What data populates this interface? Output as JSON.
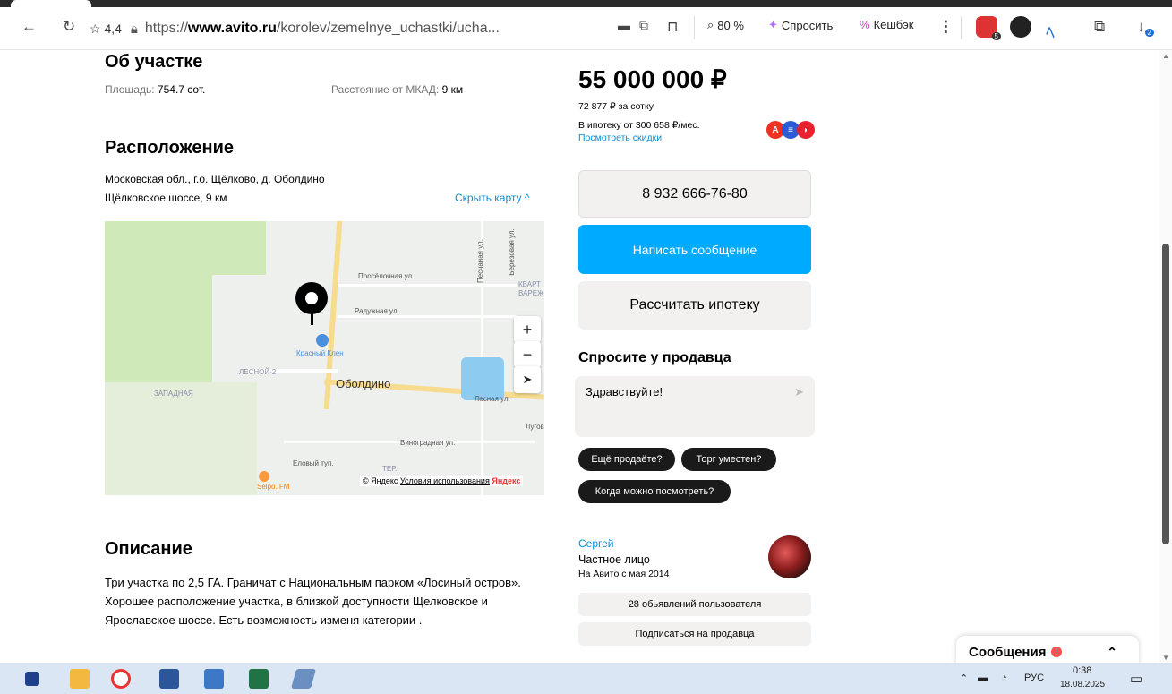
{
  "browser": {
    "rating": "☆ 4,4",
    "url_domain": "www.avito.ru",
    "url_prefix": "https://",
    "url_path": "/korolev/zemelnye_uchastki/ucha...",
    "zoom": "80 %",
    "ask_label": "Спросить",
    "cashback_label": "Кешбэк",
    "ext_badge": "5",
    "download_badge": "2"
  },
  "about": {
    "title": "Об участке",
    "area_label": "Площадь:",
    "area_value": "754.7 сот.",
    "distance_label": "Расстояние от МКАД:",
    "distance_value": "9 км"
  },
  "location": {
    "title": "Расположение",
    "address_line1": "Московская обл., г.о. Щёлково, д. Оболдино",
    "address_line2": "Щёлковское шоссе, 9 км",
    "hide_map": "Скрыть карту ^"
  },
  "map": {
    "place_big": "Оболдино",
    "label_pin_place": "Красный Клен",
    "label_proselochnaya": "Просёлочная ул.",
    "label_raduzhnaya": "Радужная ул.",
    "label_lesnoy2": "ЛЕСНОЙ-2",
    "label_zapadnaya": "ЗАПАДНАЯ",
    "label_lesnaya": "Лесная ул.",
    "label_vinogradnaya": "Виноградная ул.",
    "label_elovy": "Еловый туп.",
    "label_ter": "ТЕР.",
    "label_kvart": "КВАРТ",
    "label_varezh": "ВАРЕЖ",
    "label_lugov": "Лугов",
    "label_pesochnaya": "Песчаная ул.",
    "label_berezovaya": "Берёзовая ул.",
    "label_selpo": "Selpo. FM",
    "copyright": "© Яндекс",
    "terms": "Условия использования",
    "brand": "Яндекс"
  },
  "description": {
    "title": "Описание",
    "text": "Три участка по 2,5 ГА. Граничат с Национальным парком «Лосиный остров». Хорошее расположение участка, в близкой доступности Щелковское и Ярославское шоссе. Есть возможность изменя категории ."
  },
  "offer": {
    "price": "55 000 000 ₽",
    "per_sotka": "72 877 ₽ за сотку",
    "mortgage": "В ипотеку от 300 658 ₽/мес.",
    "discounts_link": "Посмотреть скидки",
    "phone": "8 932 666-76-80",
    "write_button": "Написать сообщение",
    "calc_button": "Рассчитать ипотеку"
  },
  "ask_seller": {
    "title": "Спросите у продавца",
    "message": "Здравствуйте!",
    "chip1": "Ещё продаёте?",
    "chip2": "Торг уместен?",
    "chip3": "Когда можно посмотреть?"
  },
  "seller": {
    "name": "Сергей",
    "type": "Частное лицо",
    "since": "На Авито с мая 2014",
    "listings_button": "28 обьявлений пользователя",
    "subscribe_button": "Подписаться на продавца"
  },
  "messages_popup": {
    "label": "Сообщения",
    "badge": "!"
  },
  "taskbar": {
    "lang": "РУС",
    "time": "0:38",
    "date": "18.08.2025"
  }
}
